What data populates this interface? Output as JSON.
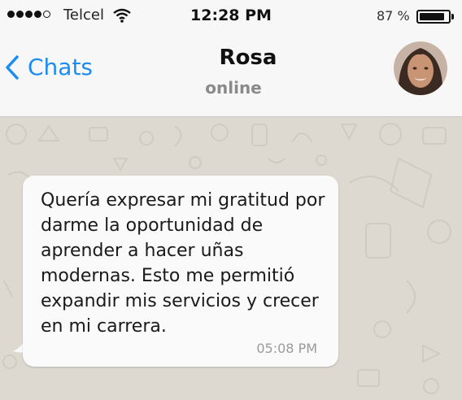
{
  "status_bar": {
    "carrier": "Telcel",
    "time": "12:28 PM",
    "battery_percent": "87 %",
    "battery_level": 0.87,
    "signal_bars": 4
  },
  "header": {
    "back_label": "Chats",
    "contact_name": "Rosa",
    "contact_status": "online"
  },
  "message": {
    "text": "Quería expresar mi gratitud por darme la oportunidad de aprender a hacer uñas modernas. Esto me permitió expandir mis servicios y crecer en mi carrera.",
    "time": "05:08 PM"
  },
  "colors": {
    "accent": "#1a8cf2",
    "chat_background": "#ddd9d1",
    "bubble": "#fafafa"
  },
  "icons": [
    "signal-dots-icon",
    "wifi-icon",
    "battery-icon",
    "chevron-left-icon"
  ]
}
